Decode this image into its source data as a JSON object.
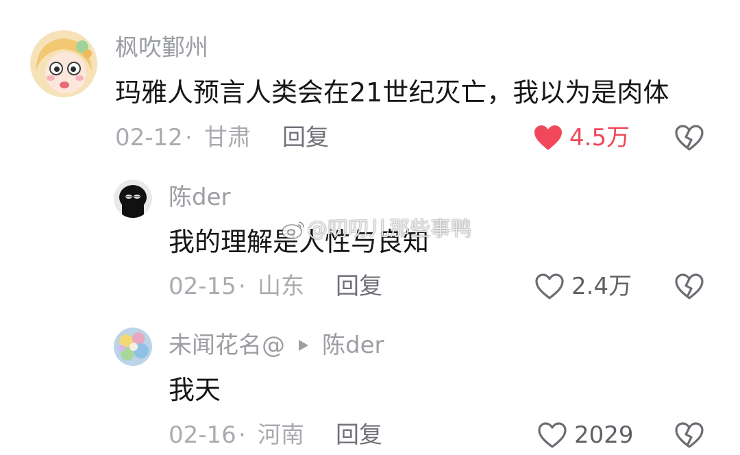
{
  "comments": [
    {
      "username": "枫吹鄞州",
      "content": "玛雅人预言人类会在21世纪灭亡，我以为是肉体",
      "date": "02-12",
      "separator": "·",
      "location": "甘肃",
      "reply_label": "回复",
      "likes": "4.5万",
      "liked": true,
      "like_color": "#f0475a"
    },
    {
      "username": "陈der",
      "content": "我的理解是人性与良知",
      "date": "02-15",
      "separator": "·",
      "location": "山东",
      "reply_label": "回复",
      "likes": "2.4万",
      "liked": false
    },
    {
      "username": "未闻花名@",
      "reply_to": "陈der",
      "content": "我天",
      "date": "02-16",
      "separator": "·",
      "location": "河南",
      "reply_label": "回复",
      "likes": "2029",
      "liked": false
    }
  ],
  "watermark": "@叨叨儿那些事鸭",
  "icons": {
    "like": "heart-icon",
    "dislike": "broken-heart-icon",
    "reply_arrow": "play-triangle-icon",
    "watermark": "weibo-logo-icon"
  }
}
